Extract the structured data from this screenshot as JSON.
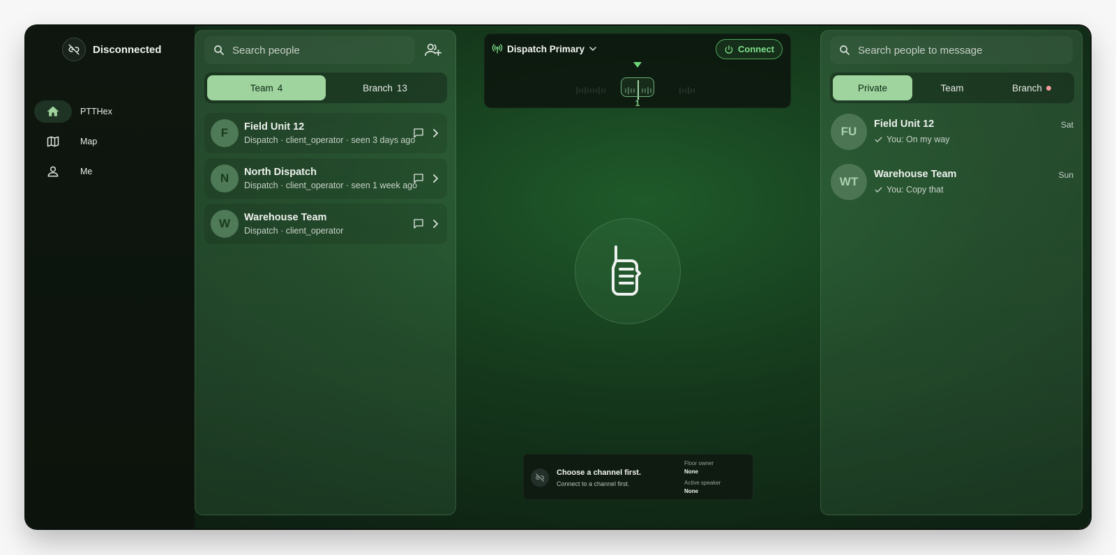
{
  "sidebar": {
    "status_label": "Disconnected",
    "items": [
      {
        "label": "PTTHex",
        "icon": "home-icon",
        "active": true
      },
      {
        "label": "Map",
        "icon": "map-icon",
        "active": false
      },
      {
        "label": "Me",
        "icon": "person-icon",
        "active": false
      }
    ]
  },
  "people": {
    "search_placeholder": "Search people",
    "tabs": [
      {
        "label": "Team",
        "count": "4",
        "active": true
      },
      {
        "label": "Branch",
        "count": "13",
        "active": false
      }
    ],
    "list": [
      {
        "initial": "F",
        "name": "Field Unit 12",
        "sub": "Dispatch · client_operator · seen 3 days ago"
      },
      {
        "initial": "N",
        "name": "North Dispatch",
        "sub": "Dispatch · client_operator · seen 1 week ago"
      },
      {
        "initial": "W",
        "name": "Warehouse Team",
        "sub": "Dispatch · client_operator"
      }
    ]
  },
  "channel": {
    "name": "Dispatch Primary",
    "connect_label": "Connect",
    "current_channel": "1"
  },
  "status_box": {
    "title": "Choose a channel first.",
    "subtitle": "Connect to a channel first.",
    "floor_owner_label": "Floor owner",
    "floor_owner_value": "None",
    "active_speaker_label": "Active speaker",
    "active_speaker_value": "None"
  },
  "messages": {
    "search_placeholder": "Search people to message",
    "tabs": [
      {
        "label": "Private",
        "active": true
      },
      {
        "label": "Team",
        "active": false
      },
      {
        "label": "Branch",
        "active": false,
        "unread": true
      }
    ],
    "conversations": [
      {
        "initials": "FU",
        "name": "Field Unit 12",
        "last": "You: On my way",
        "time": "Sat"
      },
      {
        "initials": "WT",
        "name": "Warehouse Team",
        "last": "You: Copy that",
        "time": "Sun"
      }
    ]
  },
  "colors": {
    "accent": "#9fd49f",
    "connect_green": "#7fe08a",
    "unread_dot": "#f29a9a"
  }
}
